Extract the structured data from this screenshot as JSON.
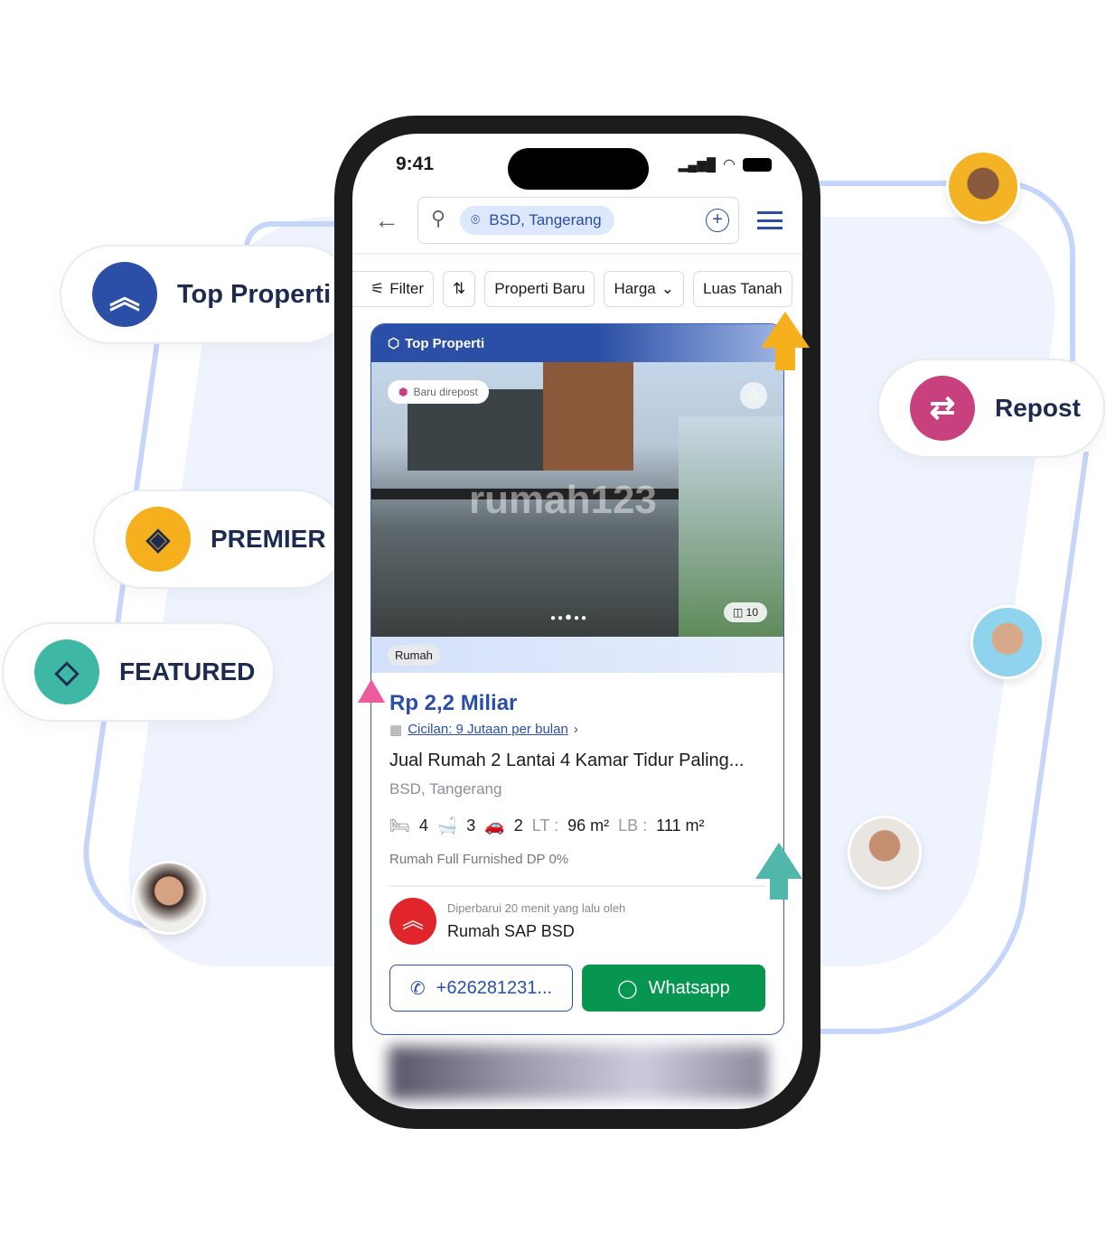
{
  "badges": {
    "top": "Top Properti",
    "premier": "PREMIER",
    "featured": "FEATURED",
    "repost": "Repost"
  },
  "status": {
    "time": "9:41"
  },
  "search": {
    "location": "BSD, Tangerang"
  },
  "chips": [
    "Filter",
    "Properti Baru",
    "Harga",
    "Luas Tanah"
  ],
  "listing": {
    "tier": "Top Properti",
    "repost_tag": "Baru direpost",
    "watermark": "rumah123",
    "photo_count": "10",
    "type": "Rumah",
    "price": "Rp 2,2 Miliar",
    "installment": "Cicilan: 9 Jutaan per bulan",
    "title": "Jual Rumah 2 Lantai 4 Kamar Tidur Paling...",
    "location": "BSD, Tangerang",
    "beds": "4",
    "baths": "3",
    "cars": "2",
    "lt_label": "LT :",
    "lt": "96 m²",
    "lb_label": "LB :",
    "lb": "111 m²",
    "tagline": "Rumah Full Furnished DP 0%",
    "updated": "Diperbarui 20 menit yang lalu oleh",
    "agent": "Rumah SAP BSD",
    "phone": "+626281231...",
    "whatsapp": "Whatsapp"
  },
  "colors": {
    "brand": "#2b4fa6",
    "whatsapp": "#06964f",
    "premier": "#f6b01e",
    "featured": "#3fb7a5",
    "repost": "#c8417e"
  }
}
